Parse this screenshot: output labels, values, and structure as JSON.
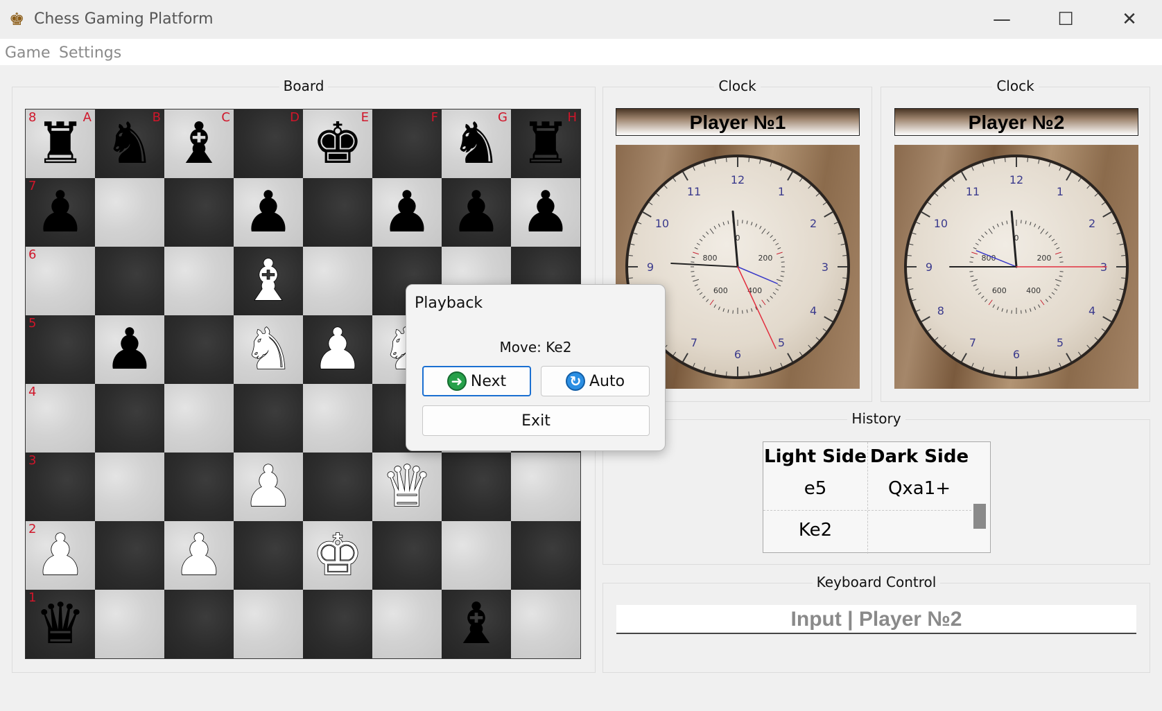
{
  "window": {
    "title": "Chess Gaming Platform",
    "icon": "crown-icon",
    "minimize": "—",
    "maximize": "☐",
    "close": "✕"
  },
  "menu": {
    "game": "Game",
    "settings": "Settings"
  },
  "board": {
    "title": "Board",
    "files": [
      "A",
      "B",
      "C",
      "D",
      "E",
      "F",
      "G",
      "H"
    ],
    "ranks": [
      "8",
      "7",
      "6",
      "5",
      "4",
      "3",
      "2",
      "1"
    ],
    "pieces": [
      {
        "square": "a8",
        "glyph": "♜",
        "color": "black",
        "name": "black-rook"
      },
      {
        "square": "b8",
        "glyph": "♞",
        "color": "black",
        "name": "black-knight"
      },
      {
        "square": "c8",
        "glyph": "♝",
        "color": "black",
        "name": "black-bishop"
      },
      {
        "square": "e8",
        "glyph": "♚",
        "color": "black",
        "name": "black-king"
      },
      {
        "square": "g8",
        "glyph": "♞",
        "color": "black",
        "name": "black-knight"
      },
      {
        "square": "h8",
        "glyph": "♜",
        "color": "black",
        "name": "black-rook"
      },
      {
        "square": "a7",
        "glyph": "♟",
        "color": "black",
        "name": "black-pawn"
      },
      {
        "square": "d7",
        "glyph": "♟",
        "color": "black",
        "name": "black-pawn"
      },
      {
        "square": "f7",
        "glyph": "♟",
        "color": "black",
        "name": "black-pawn"
      },
      {
        "square": "g7",
        "glyph": "♟",
        "color": "black",
        "name": "black-pawn"
      },
      {
        "square": "h7",
        "glyph": "♟",
        "color": "black",
        "name": "black-pawn"
      },
      {
        "square": "d6",
        "glyph": "♝",
        "color": "white",
        "name": "white-bishop"
      },
      {
        "square": "b5",
        "glyph": "♟",
        "color": "black",
        "name": "black-pawn"
      },
      {
        "square": "d5",
        "glyph": "♞",
        "color": "white",
        "name": "white-knight"
      },
      {
        "square": "e5",
        "glyph": "♟",
        "color": "white",
        "name": "white-pawn"
      },
      {
        "square": "f5",
        "glyph": "♞",
        "color": "white",
        "name": "white-knight"
      },
      {
        "square": "d3",
        "glyph": "♟",
        "color": "white",
        "name": "white-pawn"
      },
      {
        "square": "f3",
        "glyph": "♛",
        "color": "white",
        "name": "white-queen"
      },
      {
        "square": "a2",
        "glyph": "♟",
        "color": "white",
        "name": "white-pawn"
      },
      {
        "square": "c2",
        "glyph": "♟",
        "color": "white",
        "name": "white-pawn"
      },
      {
        "square": "e2",
        "glyph": "♚",
        "color": "white",
        "name": "white-king"
      },
      {
        "square": "a1",
        "glyph": "♛",
        "color": "black",
        "name": "black-queen"
      },
      {
        "square": "g1",
        "glyph": "♝",
        "color": "black",
        "name": "black-bishop"
      }
    ]
  },
  "clocks": [
    {
      "title": "Clock",
      "player": "Player №1",
      "hour_labels": [
        "12",
        "1",
        "2",
        "3",
        "4",
        "5",
        "6",
        "7",
        "8",
        "9",
        "10",
        "11"
      ],
      "sub_labels": [
        "0",
        "200",
        "400",
        "600",
        "800"
      ],
      "hour_angle": -5,
      "minute_angle": 273,
      "second_angle": 155,
      "sub_angle": 113
    },
    {
      "title": "Clock",
      "player": "Player №2",
      "hour_labels": [
        "12",
        "1",
        "2",
        "3",
        "4",
        "5",
        "6",
        "7",
        "8",
        "9",
        "10",
        "11"
      ],
      "sub_labels": [
        "0",
        "200",
        "400",
        "600",
        "800"
      ],
      "hour_angle": -5,
      "minute_angle": 270,
      "second_angle": 90,
      "sub_angle": 292
    }
  ],
  "history": {
    "title": "History",
    "columns": [
      "Light Side",
      "Dark Side"
    ],
    "rows": [
      [
        "e5",
        "Qxa1+"
      ],
      [
        "Ke2",
        ""
      ]
    ]
  },
  "keyboard": {
    "title": "Keyboard Control",
    "input_value": "Input | Player №2"
  },
  "dialog": {
    "title": "Playback",
    "move_text": "Move: Ke2",
    "next_label": "Next",
    "auto_label": "Auto",
    "exit_label": "Exit",
    "next_icon": "arrow-right-icon",
    "auto_icon": "refresh-icon"
  },
  "colors": {
    "coord_red": "#d0162a",
    "clock_numerals": "#3a3a8c",
    "accent_blue": "#1a6fd1"
  }
}
